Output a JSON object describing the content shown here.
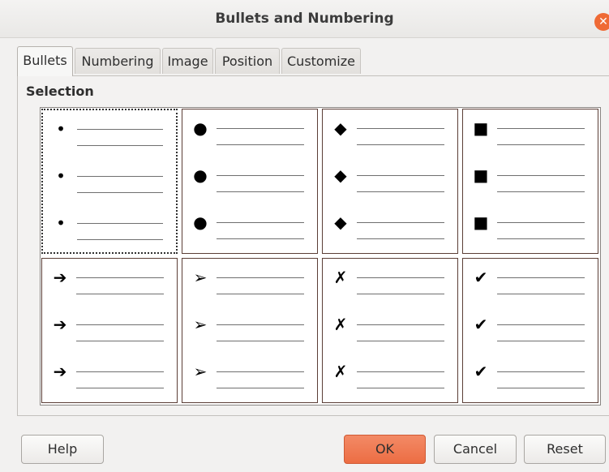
{
  "window": {
    "title": "Bullets and Numbering",
    "close_glyph": "✕"
  },
  "tabs": [
    {
      "label": "Bullets",
      "active": true
    },
    {
      "label": "Numbering",
      "active": false
    },
    {
      "label": "Image",
      "active": false
    },
    {
      "label": "Position",
      "active": false
    },
    {
      "label": "Customize",
      "active": false
    }
  ],
  "selection": {
    "label": "Selection",
    "styles": [
      {
        "name": "small-dot",
        "symbol": "•",
        "selected": true
      },
      {
        "name": "large-dot",
        "symbol": "●",
        "selected": false
      },
      {
        "name": "diamond",
        "symbol": "◆",
        "selected": false
      },
      {
        "name": "square",
        "symbol": "■",
        "selected": false
      },
      {
        "name": "arrow",
        "symbol": "➔",
        "selected": false
      },
      {
        "name": "arrowhead",
        "symbol": "➢",
        "selected": false
      },
      {
        "name": "cross",
        "symbol": "✗",
        "selected": false
      },
      {
        "name": "check",
        "symbol": "✔",
        "selected": false
      }
    ]
  },
  "buttons": {
    "help": "Help",
    "ok": "OK",
    "cancel": "Cancel",
    "reset": "Reset"
  },
  "colors": {
    "accent": "#ec6d43",
    "panel_bg": "#f2f1f0"
  }
}
